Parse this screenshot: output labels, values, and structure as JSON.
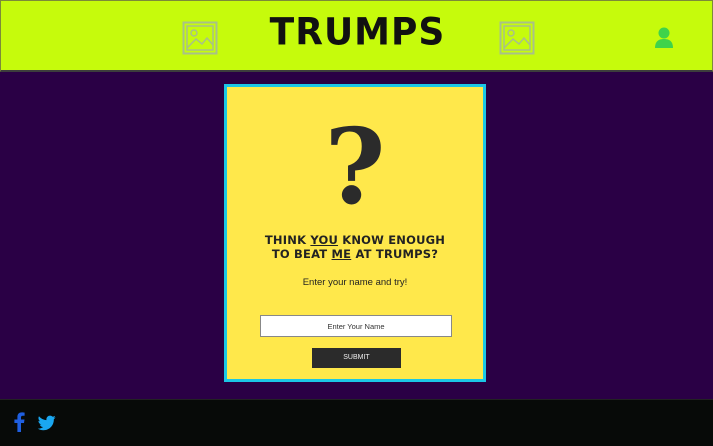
{
  "header": {
    "logo_text": "TRUMPS",
    "background_color": "#c6fb0c",
    "left_image_icon": "broken-image-icon",
    "right_image_icon": "broken-image-icon",
    "user_icon": "user-icon",
    "user_icon_color": "#3fd34a"
  },
  "card": {
    "question_mark": "?",
    "headline_line1_prefix": "THINK ",
    "headline_line1_emphasis": "YOU",
    "headline_line1_suffix": " KNOW ENOUGH",
    "headline_line2_prefix": "TO BEAT ",
    "headline_line2_emphasis": "ME",
    "headline_line2_suffix": " AT TRUMPS?",
    "subtitle": "Enter your name and try!",
    "name_placeholder": "Enter Your Name",
    "name_value": "",
    "submit_label": "SUBMIT",
    "background_color": "#ffe84b",
    "border_color": "#1cc6e6"
  },
  "footer": {
    "facebook_icon": "facebook-icon",
    "twitter_icon": "twitter-icon",
    "facebook_color": "#1f5fe0",
    "twitter_color": "#1aa7f0"
  }
}
